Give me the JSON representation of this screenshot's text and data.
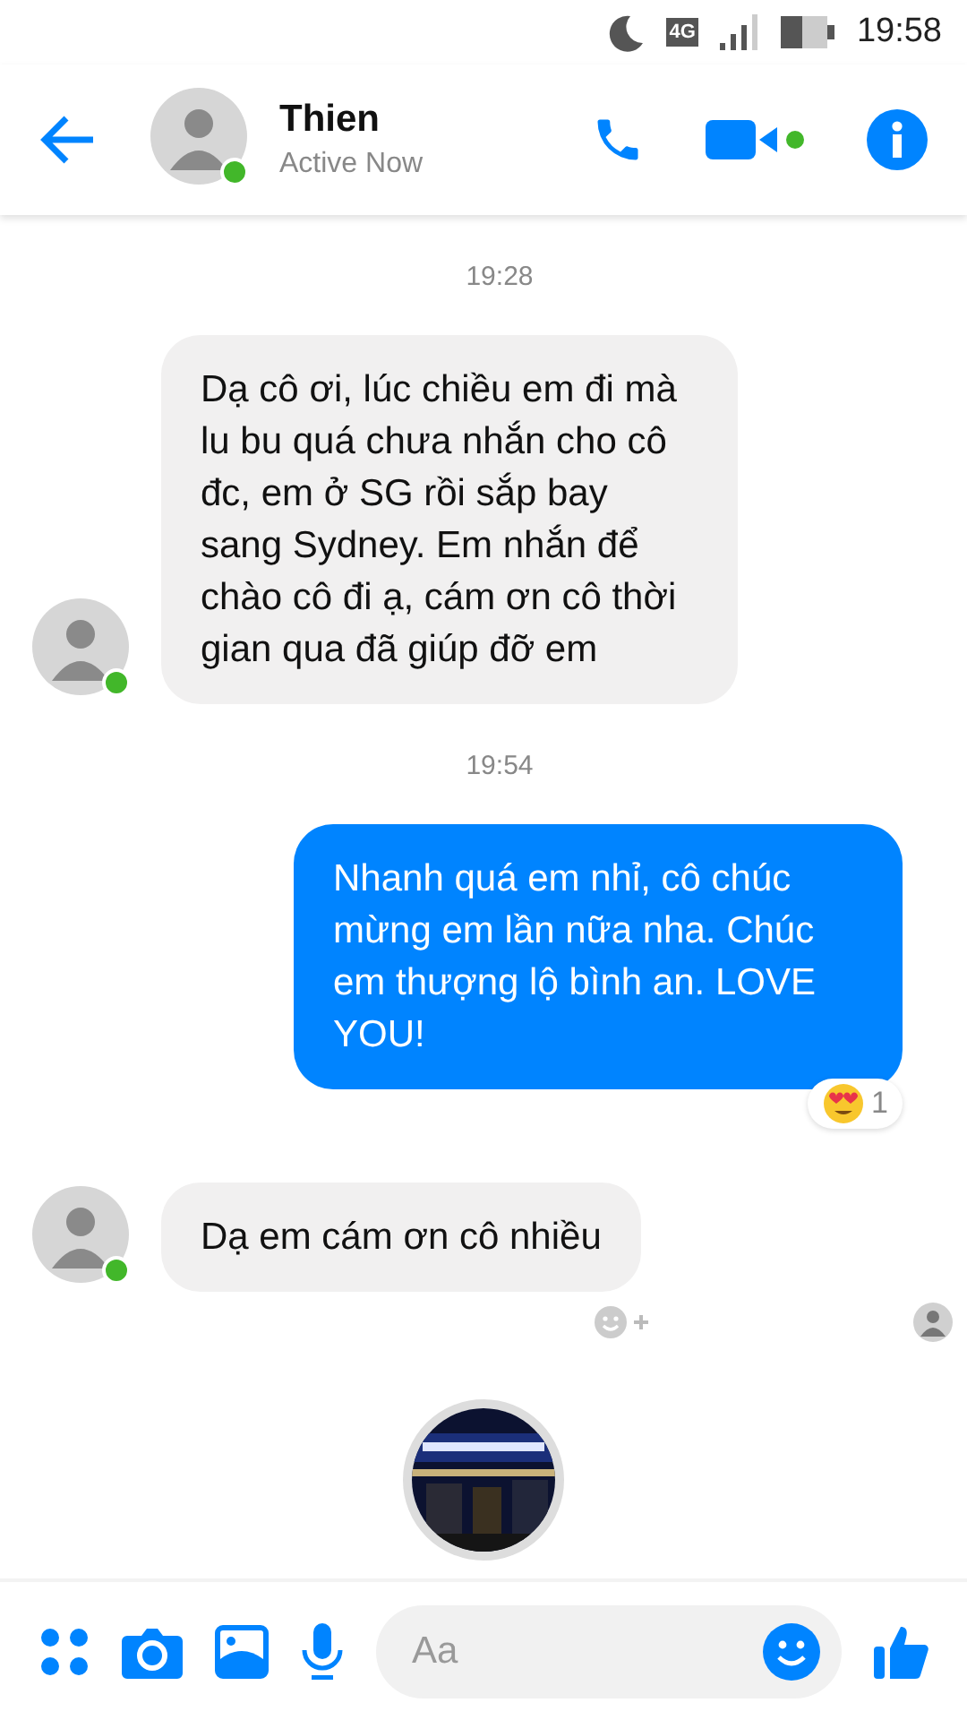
{
  "status_bar": {
    "network": "4G",
    "time": "19:58"
  },
  "header": {
    "name": "Thien",
    "status": "Active Now",
    "online": true
  },
  "messages": [
    {
      "kind": "timestamp",
      "text": "19:28"
    },
    {
      "kind": "received",
      "text": "Dạ cô ơi, lúc chiều em đi mà lu bu quá chưa nhắn cho cô đc, em ở SG rồi sắp bay sang Sydney. Em nhắn để chào cô đi ạ, cám ơn cô thời gian qua đã giúp đỡ em",
      "show_avatar": true,
      "online": true
    },
    {
      "kind": "timestamp",
      "text": "19:54"
    },
    {
      "kind": "sent",
      "text": "Nhanh quá em nhỉ, cô chúc mừng em lần nữa nha. Chúc em thượng lộ bình an. LOVE YOU!",
      "reaction_count": "1"
    },
    {
      "kind": "received",
      "text": "Dạ em cám ơn cô nhiều",
      "show_avatar": true,
      "online": true,
      "add_reaction": true,
      "seen": true
    }
  ],
  "composer": {
    "placeholder": "Aa"
  }
}
